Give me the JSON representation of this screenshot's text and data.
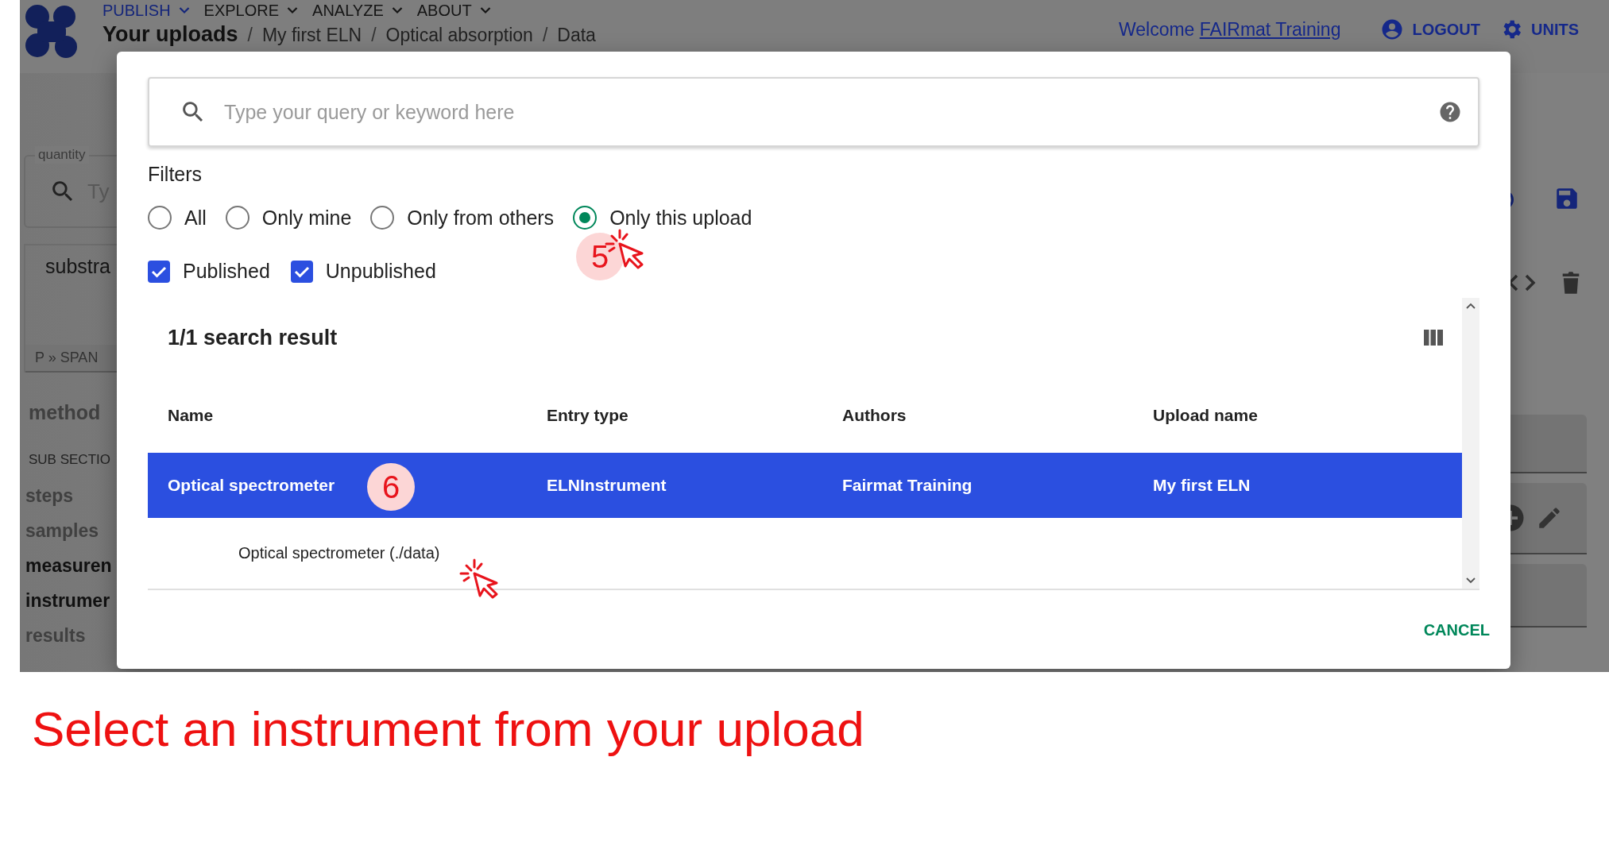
{
  "header": {
    "nav": [
      {
        "label": "PUBLISH",
        "selected": true
      },
      {
        "label": "EXPLORE",
        "selected": false
      },
      {
        "label": "ANALYZE",
        "selected": false
      },
      {
        "label": "ABOUT",
        "selected": false
      }
    ],
    "breadcrumbs": [
      "Your uploads",
      "My first ELN",
      "Optical absorption",
      "Data"
    ],
    "separator": "/",
    "welcome": "Welcome",
    "user": "FAIRmat Training",
    "actions": [
      "LOGOUT",
      "UNITS"
    ]
  },
  "left_panel": {
    "quantity_field": {
      "label": "quantity",
      "placeholder": "Ty"
    },
    "preview_text": "substra",
    "path": "P » SPAN",
    "method": "method",
    "subsections_heading": "SUB SECTIO",
    "subsections": [
      {
        "label": "steps",
        "populated": false
      },
      {
        "label": "samples",
        "populated": false
      },
      {
        "label": "measuren",
        "populated": true
      },
      {
        "label": "instrumer",
        "populated": true
      },
      {
        "label": "results",
        "populated": false
      }
    ]
  },
  "dialog": {
    "search": {
      "placeholder": "Type your query or keyword here"
    },
    "filters_label": "Filters",
    "scope": [
      {
        "label": "All",
        "selected": false
      },
      {
        "label": "Only mine",
        "selected": false
      },
      {
        "label": "Only from others",
        "selected": false
      },
      {
        "label": "Only this upload",
        "selected": true
      }
    ],
    "status": [
      {
        "label": "Published",
        "checked": true
      },
      {
        "label": "Unpublished",
        "checked": true
      }
    ],
    "results": {
      "title": "1/1 search result",
      "columns": [
        "Name",
        "Entry type",
        "Authors",
        "Upload name"
      ],
      "rows": [
        {
          "cells": [
            "Optical spectrometer",
            "ELNInstrument",
            "Fairmat Training",
            "My first ELN"
          ],
          "selected": true,
          "expanded": true,
          "detail": "Optical spectrometer (./data)"
        }
      ]
    },
    "buttons": [
      "CANCEL"
    ]
  },
  "annotations": [
    {
      "number": "5"
    },
    {
      "number": "6"
    }
  ],
  "caption": "Select an instrument from your upload"
}
